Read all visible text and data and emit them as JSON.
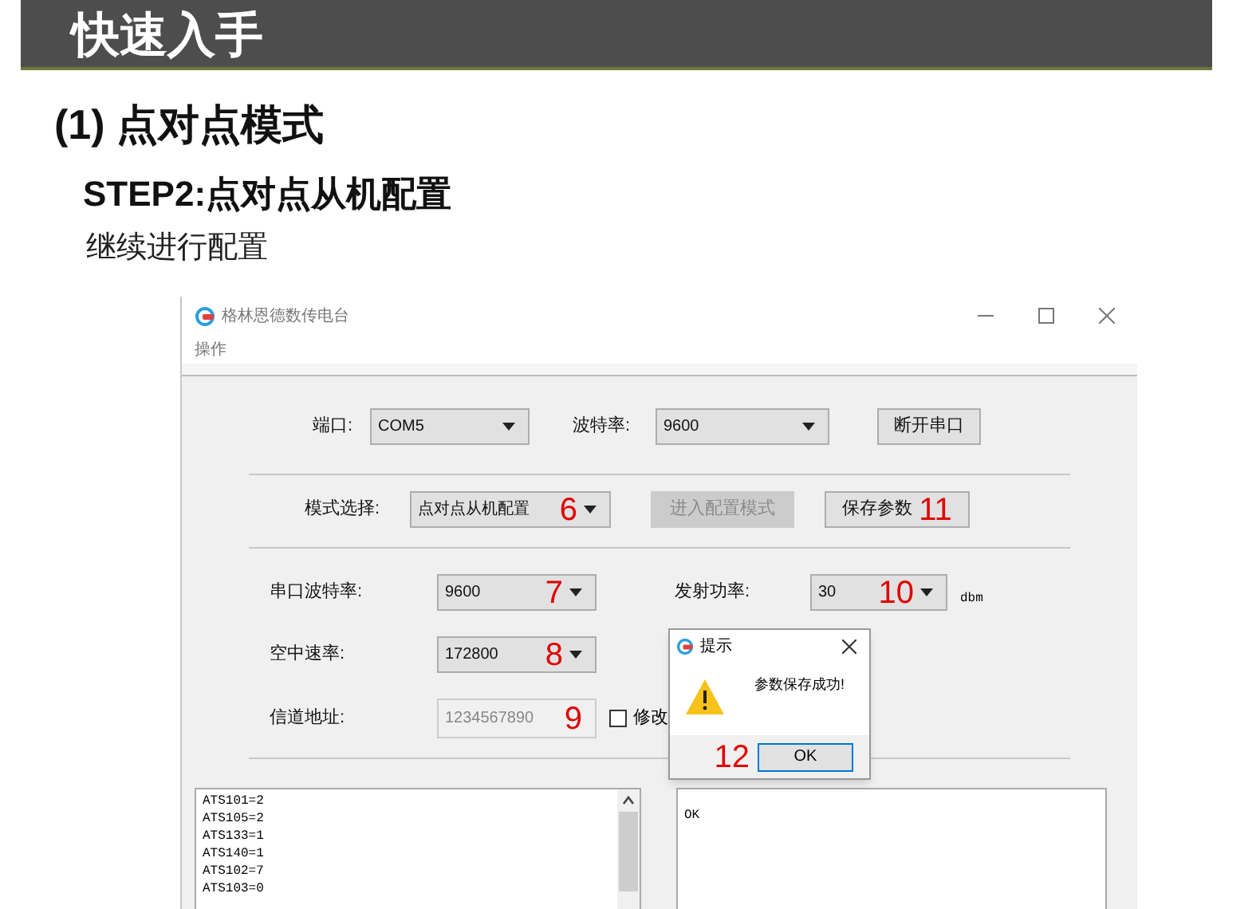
{
  "header": {
    "title": "快速入手"
  },
  "heading": "(1) 点对点模式",
  "subheading": "STEP2:点对点从机配置",
  "intro": "继续进行配置",
  "window": {
    "title": "格林恩德数传电台",
    "menu": [
      "操作"
    ],
    "port_row": [
      {
        "kind": "combo",
        "label": "端口:",
        "value": "COM5"
      },
      {
        "kind": "combo",
        "label": "波特率:",
        "value": "9600"
      },
      {
        "kind": "button",
        "label": "断开串口",
        "disabled": false
      }
    ],
    "mode_row": [
      {
        "kind": "combo",
        "label": "模式选择:",
        "value": "点对点从机配置",
        "marker": "6"
      },
      {
        "kind": "button",
        "label": "进入配置模式",
        "disabled": true
      },
      {
        "kind": "button",
        "label": "保存参数",
        "disabled": false,
        "marker": "11"
      }
    ],
    "params": [
      {
        "kind": "combo",
        "label": "串口波特率:",
        "value": "9600",
        "marker": "7"
      },
      {
        "kind": "combo",
        "label": "发射功率:",
        "value": "30",
        "marker": "10",
        "unit": "dbm"
      },
      {
        "kind": "combo",
        "label": "空中速率:",
        "value": "172800",
        "marker": "8"
      },
      {
        "kind": "field",
        "label": "信道地址:",
        "value": "1234567890",
        "marker": "9",
        "disabled": true,
        "checkbox": {
          "label": "修改",
          "checked": false
        }
      }
    ],
    "log": [
      "ATS101=2",
      "ATS105=2",
      "ATS133=1",
      "ATS140=1",
      "ATS102=7",
      "ATS103=0"
    ],
    "response": "OK",
    "dialog": {
      "title": "提示",
      "message": "参数保存成功!",
      "button": "OK",
      "marker": "12"
    }
  }
}
